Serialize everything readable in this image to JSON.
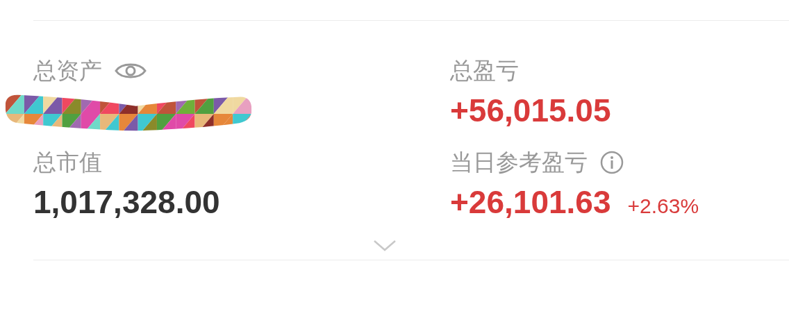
{
  "summary": [
    {
      "kind": "masked",
      "label": "总资产"
    },
    {
      "kind": "plain",
      "label": "总盈亏",
      "value": "+56,015.05",
      "color": "#d93a3a"
    },
    {
      "kind": "plain",
      "label": "总市值",
      "value": "1,017,328.00",
      "color": "#333333"
    },
    {
      "kind": "info",
      "label": "当日参考盈亏",
      "value": "+26,101.63",
      "change": "+2.63%",
      "color": "#d93a3a"
    }
  ]
}
